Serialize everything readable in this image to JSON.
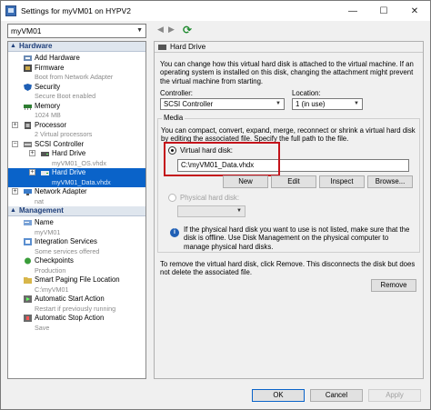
{
  "window": {
    "title": "Settings for myVM01 on HYPV2",
    "buttons": [
      "—",
      "☐",
      "✕"
    ]
  },
  "toolbar": {
    "vm_selected": "myVM01"
  },
  "tree": {
    "hardware_header": "Hardware",
    "management_header": "Management",
    "hardware": [
      {
        "label": "Add Hardware",
        "sub": ""
      },
      {
        "label": "Firmware",
        "sub": "Boot from Network Adapter"
      },
      {
        "label": "Security",
        "sub": "Secure Boot enabled"
      },
      {
        "label": "Memory",
        "sub": "1024 MB"
      },
      {
        "label": "Processor",
        "sub": "2 Virtual processors"
      },
      {
        "label": "SCSI Controller",
        "sub": ""
      },
      {
        "label": "Hard Drive",
        "sub": "myVM01_OS.vhdx"
      },
      {
        "label": "Hard Drive",
        "sub": "myVM01_Data.vhdx"
      },
      {
        "label": "Network Adapter",
        "sub": "nat"
      }
    ],
    "management": [
      {
        "label": "Name",
        "sub": "myVM01"
      },
      {
        "label": "Integration Services",
        "sub": "Some services offered"
      },
      {
        "label": "Checkpoints",
        "sub": "Production"
      },
      {
        "label": "Smart Paging File Location",
        "sub": "C:\\myVM01"
      },
      {
        "label": "Automatic Start Action",
        "sub": "Restart if previously running"
      },
      {
        "label": "Automatic Stop Action",
        "sub": "Save"
      }
    ]
  },
  "detail": {
    "header": "Hard Drive",
    "description": "You can change how this virtual hard disk is attached to the virtual machine. If an operating system is installed on this disk, changing the attachment might prevent the virtual machine from starting.",
    "controller_label": "Controller:",
    "controller_value": "SCSI Controller",
    "location_label": "Location:",
    "location_value": "1 (in use)",
    "media_title": "Media",
    "media_description": "You can compact, convert, expand, merge, reconnect or shrink a virtual hard disk by editing the associated file. Specify the full path to the file.",
    "vhd_label": "Virtual hard disk:",
    "vhd_path": "C:\\myVM01_Data.vhdx",
    "buttons": {
      "new": "New",
      "edit": "Edit",
      "inspect": "Inspect",
      "browse": "Browse..."
    },
    "physical_label": "Physical hard disk:",
    "info_text": "If the physical hard disk you want to use is not listed, make sure that the disk is offline. Use Disk Management on the physical computer to manage physical hard disks.",
    "remove_text": "To remove the virtual hard disk, click Remove. This disconnects the disk but does not delete the associated file.",
    "remove_button": "Remove"
  },
  "dialog": {
    "ok": "OK",
    "cancel": "Cancel",
    "apply": "Apply"
  }
}
